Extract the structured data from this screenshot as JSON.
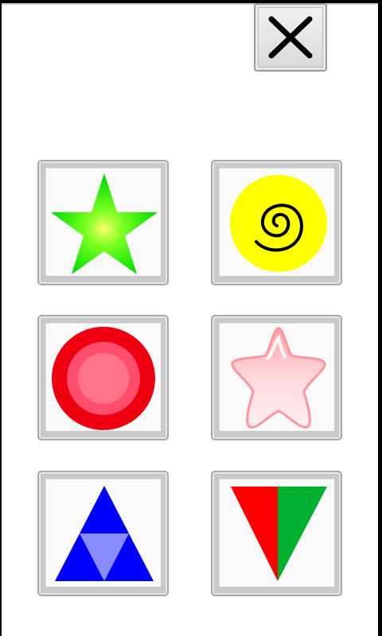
{
  "close_button": {
    "icon": "close-icon"
  },
  "shape_grid": {
    "tiles": [
      {
        "icon": "green-star-icon",
        "colors": [
          "#00ee00",
          "#f4ff5a"
        ]
      },
      {
        "icon": "yellow-spiral-icon",
        "colors": [
          "#ffff00",
          "#000000"
        ]
      },
      {
        "icon": "red-circle-icon",
        "colors": [
          "#ee0011",
          "#ff5577",
          "#ff7a90"
        ]
      },
      {
        "icon": "pink-glossy-star-icon",
        "colors": [
          "#ffb3b8",
          "#ffffff"
        ]
      },
      {
        "icon": "blue-triangle-icon",
        "colors": [
          "#0000ff",
          "#8888ff"
        ]
      },
      {
        "icon": "red-green-triangle-icon",
        "colors": [
          "#ff0000",
          "#00b030"
        ]
      }
    ]
  }
}
